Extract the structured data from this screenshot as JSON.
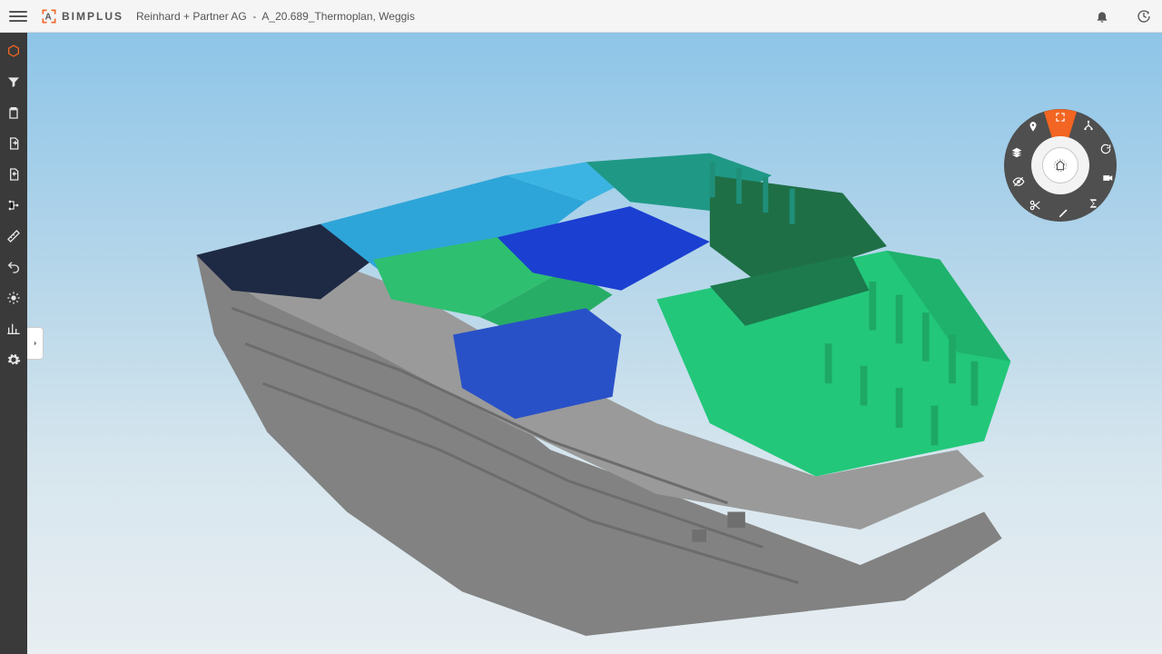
{
  "brand": {
    "name": "BIMPLUS"
  },
  "breadcrumb": {
    "team": "Reinhard + Partner AG",
    "separator": "-",
    "project": "A_20.689_Thermoplan, Weggis"
  },
  "topbar_icons": {
    "notifications": "notifications",
    "history": "history"
  },
  "sidebar": {
    "items": [
      {
        "name": "model-explorer",
        "icon": "cube",
        "active": true
      },
      {
        "name": "filter",
        "icon": "filter",
        "active": false
      },
      {
        "name": "clipboard",
        "icon": "clipboard",
        "active": false
      },
      {
        "name": "documents",
        "icon": "document-out",
        "active": false
      },
      {
        "name": "revisions",
        "icon": "document-in",
        "active": false
      },
      {
        "name": "structure",
        "icon": "nodes",
        "active": false
      },
      {
        "name": "measure",
        "icon": "ruler",
        "active": false
      },
      {
        "name": "undo",
        "icon": "undo",
        "active": false
      },
      {
        "name": "sun",
        "icon": "sun",
        "active": false
      },
      {
        "name": "compare",
        "icon": "chart",
        "active": false
      },
      {
        "name": "settings",
        "icon": "gear",
        "active": false
      }
    ]
  },
  "radial_menu": {
    "center": "home",
    "slots": [
      {
        "name": "fullscreen",
        "icon": "expand",
        "highlight": true
      },
      {
        "name": "hierarchy",
        "icon": "tree",
        "highlight": false
      },
      {
        "name": "refresh",
        "icon": "refresh",
        "highlight": false
      },
      {
        "name": "camera",
        "icon": "camera",
        "highlight": false
      },
      {
        "name": "sum",
        "icon": "sigma",
        "highlight": false
      },
      {
        "name": "edit",
        "icon": "pencil",
        "highlight": false
      },
      {
        "name": "cut",
        "icon": "scissors",
        "highlight": false
      },
      {
        "name": "hide",
        "icon": "eye-off",
        "highlight": false
      },
      {
        "name": "layers",
        "icon": "layers",
        "highlight": false
      },
      {
        "name": "pin",
        "icon": "pin",
        "highlight": false
      }
    ]
  },
  "colors": {
    "accent": "#f26522",
    "sidebar_bg": "#3a3a3a",
    "radial_bg": "#4f4f4f",
    "model_gray": "#8e8e8e",
    "model_gray_dark": "#6f6f6f",
    "model_darknavy": "#1e2a44",
    "model_skyblue": "#2ea5d8",
    "model_green": "#2fbf71",
    "model_darkgreen": "#1f6f46",
    "model_blue": "#1b3fd1",
    "model_royalblue": "#2951c7",
    "model_teal": "#1f8f7a",
    "model_emerald": "#23c77a"
  }
}
